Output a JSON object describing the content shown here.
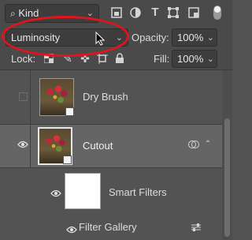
{
  "filter": {
    "kind_label": "Kind",
    "icons": [
      "image-filter-icon",
      "adjustment-filter-icon",
      "type-filter-icon",
      "shape-filter-icon",
      "smart-object-filter-icon"
    ]
  },
  "blend": {
    "mode": "Luminosity",
    "opacity_label": "Opacity:",
    "opacity_value": "100%"
  },
  "lock": {
    "label": "Lock:",
    "fill_label": "Fill:",
    "fill_value": "100%"
  },
  "layers": [
    {
      "name": "Dry Brush",
      "visible": false
    },
    {
      "name": "Cutout",
      "visible": true,
      "selected": true
    },
    {
      "name": "Smart Filters"
    },
    {
      "name": "Filter Gallery"
    }
  ],
  "colors": {
    "panel_bg": "#535353",
    "selected_row": "#656565",
    "highlight_circle": "#e0141e"
  }
}
